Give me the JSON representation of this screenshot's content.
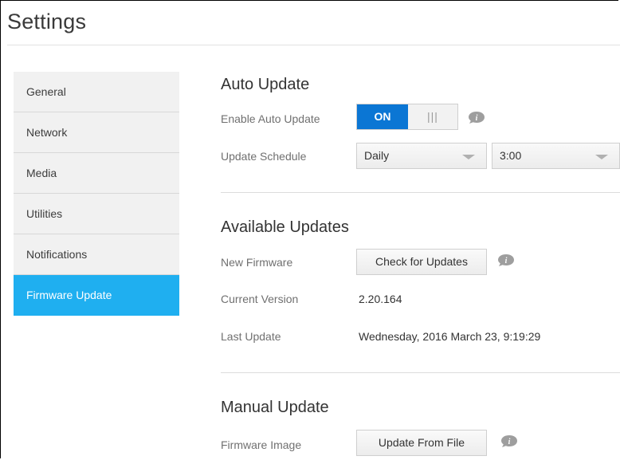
{
  "header": {
    "title": "Settings"
  },
  "sidebar": {
    "items": [
      {
        "label": "General"
      },
      {
        "label": "Network"
      },
      {
        "label": "Media"
      },
      {
        "label": "Utilities"
      },
      {
        "label": "Notifications"
      },
      {
        "label": "Firmware Update",
        "active": true
      }
    ]
  },
  "auto_update": {
    "title": "Auto Update",
    "enable_label": "Enable Auto Update",
    "toggle_on": "ON",
    "toggle_off": "|||",
    "schedule_label": "Update Schedule",
    "schedule_value": "Daily",
    "time_value": "3:00"
  },
  "available_updates": {
    "title": "Available Updates",
    "new_firmware_label": "New Firmware",
    "check_button": "Check for Updates",
    "current_version_label": "Current Version",
    "current_version_value": "2.20.164",
    "last_update_label": "Last Update",
    "last_update_value": "Wednesday, 2016 March 23, 9:19:29"
  },
  "manual_update": {
    "title": "Manual Update",
    "firmware_image_label": "Firmware Image",
    "update_button": "Update From File"
  },
  "colors": {
    "accent": "#1faff0",
    "toggle_on": "#0b76d4",
    "icon": "#9e9e9e"
  },
  "icons": {
    "info": "info-speech-bubble-icon"
  }
}
